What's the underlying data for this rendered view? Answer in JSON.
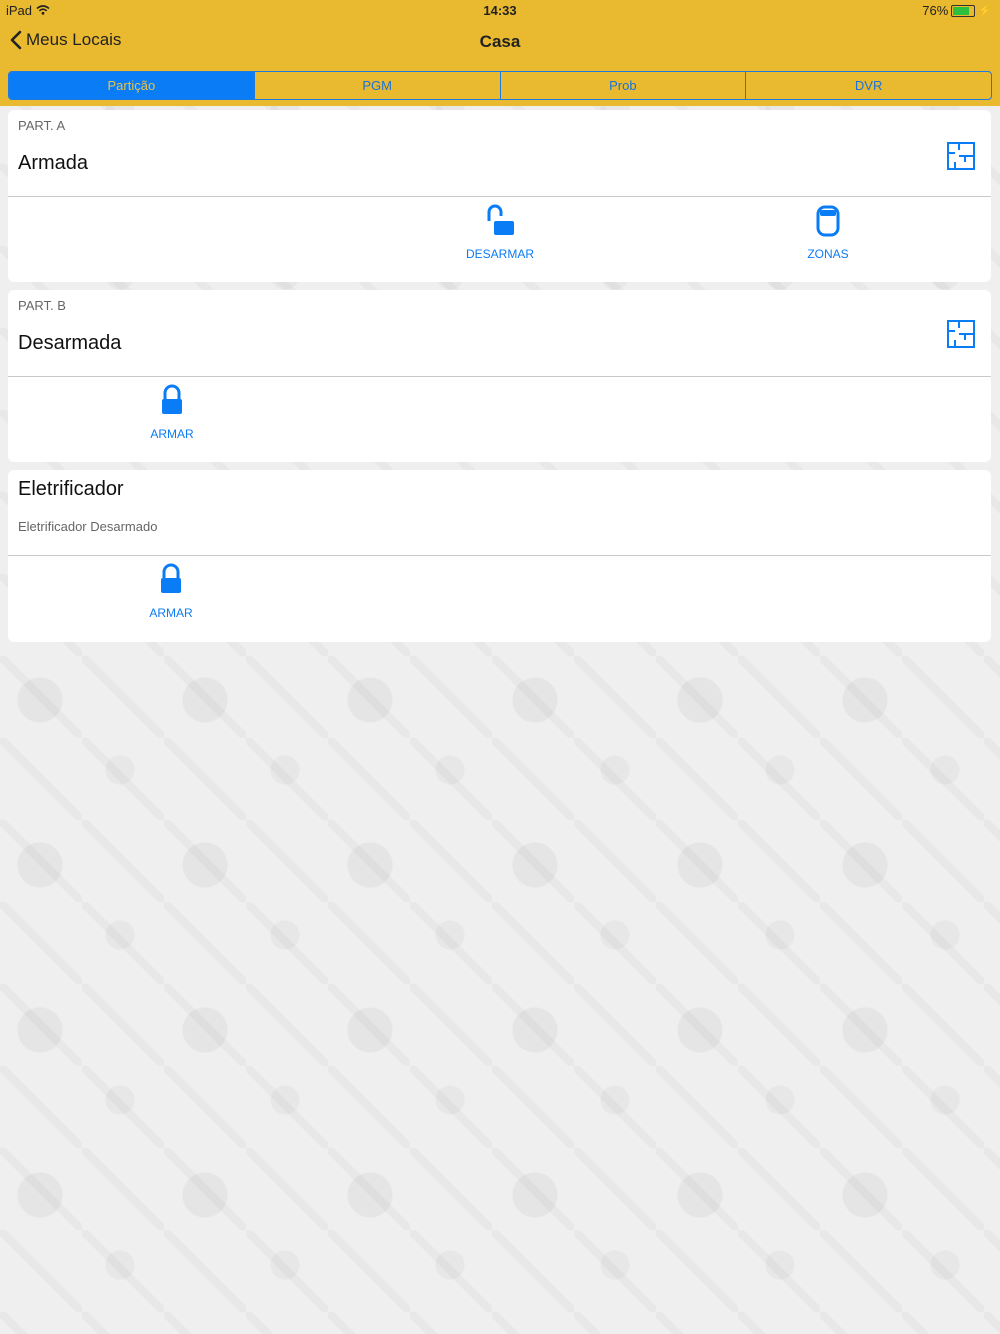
{
  "status_bar": {
    "device": "iPad",
    "time": "14:33",
    "battery": "76%"
  },
  "nav": {
    "back_label": "Meus Locais",
    "title": "Casa"
  },
  "tabs": [
    {
      "label": "Partição",
      "active": true
    },
    {
      "label": "PGM",
      "active": false
    },
    {
      "label": "Prob",
      "active": false
    },
    {
      "label": "DVR",
      "active": false
    }
  ],
  "partitions": [
    {
      "label": "PART. A",
      "status": "Armada",
      "actions": [
        {
          "label": "DESARMAR",
          "icon": "unlock-icon"
        },
        {
          "label": "ZONAS",
          "icon": "sensor-icon"
        }
      ]
    },
    {
      "label": "PART. B",
      "status": "Desarmada",
      "actions": [
        {
          "label": "ARMAR",
          "icon": "lock-icon"
        }
      ]
    }
  ],
  "electrifier": {
    "title": "Eletrificador",
    "status": "Eletrificador Desarmado",
    "actions": [
      {
        "label": "ARMAR",
        "icon": "lock-icon"
      }
    ]
  },
  "colors": {
    "accent": "#0a7cf5",
    "header": "#e9b930"
  }
}
